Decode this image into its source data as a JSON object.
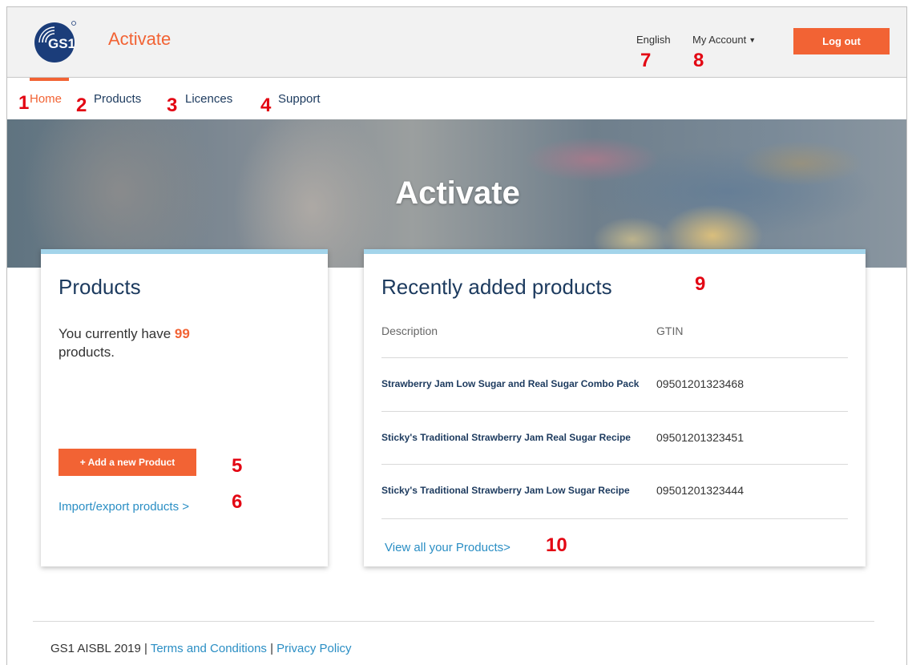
{
  "header": {
    "logo_text": "GS1",
    "app_title": "Activate",
    "language": "English",
    "account": "My Account",
    "logout": "Log out"
  },
  "nav": {
    "items": [
      {
        "label": "Home",
        "active": true
      },
      {
        "label": "Products"
      },
      {
        "label": "Licences"
      },
      {
        "label": "Support"
      }
    ]
  },
  "hero": {
    "title": "Activate"
  },
  "products_card": {
    "title": "Products",
    "count_prefix": "You currently have",
    "count": "99",
    "count_suffix": "products.",
    "add_button": "+ Add a new Product",
    "import_link": "Import/export products >"
  },
  "recent_card": {
    "title": "Recently added products",
    "columns": [
      "Description",
      "GTIN"
    ],
    "rows": [
      {
        "description": "Strawberry Jam Low Sugar and Real Sugar Combo Pack",
        "gtin": "09501201323468"
      },
      {
        "description": "Sticky's Traditional Strawberry Jam Real Sugar Recipe",
        "gtin": "09501201323451"
      },
      {
        "description": "Sticky's Traditional Strawberry Jam Low Sugar Recipe",
        "gtin": "09501201323444"
      }
    ],
    "view_all": "View all your Products>"
  },
  "footer": {
    "copyright": "GS1 AISBL 2019",
    "separator": "|",
    "terms": "Terms and Conditions",
    "privacy": "Privacy Policy"
  },
  "annotations": [
    "1",
    "2",
    "3",
    "4",
    "5",
    "6",
    "7",
    "8",
    "9",
    "10"
  ],
  "colors": {
    "accent": "#f26334",
    "navy": "#1c3a5e",
    "link": "#2a8ec4",
    "card_top": "#a3d4ea",
    "annotation": "#e30613"
  }
}
